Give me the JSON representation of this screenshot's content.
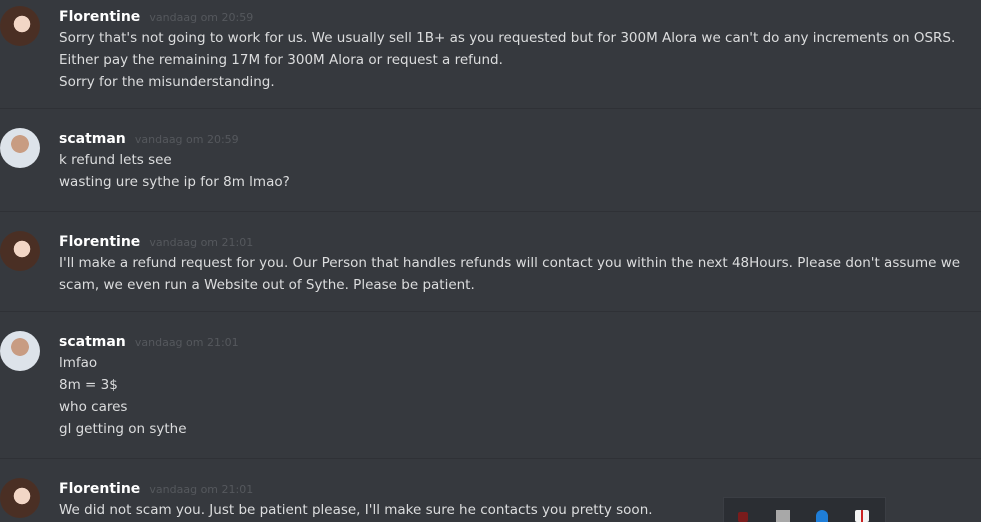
{
  "messages": [
    {
      "author": "Florentine",
      "timestamp": "vandaag om 20:59",
      "lines": [
        "Sorry that's not going to work for us. We usually sell 1B+ as you requested but for 300M Alora we can't do any increments on OSRS. Either pay the remaining 17M for 300M Alora or request a refund.",
        "Sorry for the misunderstanding."
      ]
    },
    {
      "author": "scatman",
      "timestamp": "vandaag om 20:59",
      "lines": [
        "k refund lets see",
        "wasting ure sythe ip for 8m lmao?"
      ]
    },
    {
      "author": "Florentine",
      "timestamp": "vandaag om 21:01",
      "lines": [
        "I'll make a refund request for you. Our Person that handles refunds will contact you within the next 48Hours. Please don't assume we scam, we even run a Website out of Sythe. Please be patient."
      ]
    },
    {
      "author": "scatman",
      "timestamp": "vandaag om 21:01",
      "lines": [
        "lmfao",
        "8m = 3$",
        "who cares",
        "gl getting on sythe"
      ]
    },
    {
      "author": "Florentine",
      "timestamp": "vandaag om 21:01",
      "lines": [
        "We did not scam you. Just be patient please, I'll make sure he contacts you pretty soon."
      ]
    }
  ],
  "tray": {
    "icons": [
      "app-icon",
      "window-icon",
      "bluetooth-icon",
      "security-shield-icon"
    ]
  }
}
